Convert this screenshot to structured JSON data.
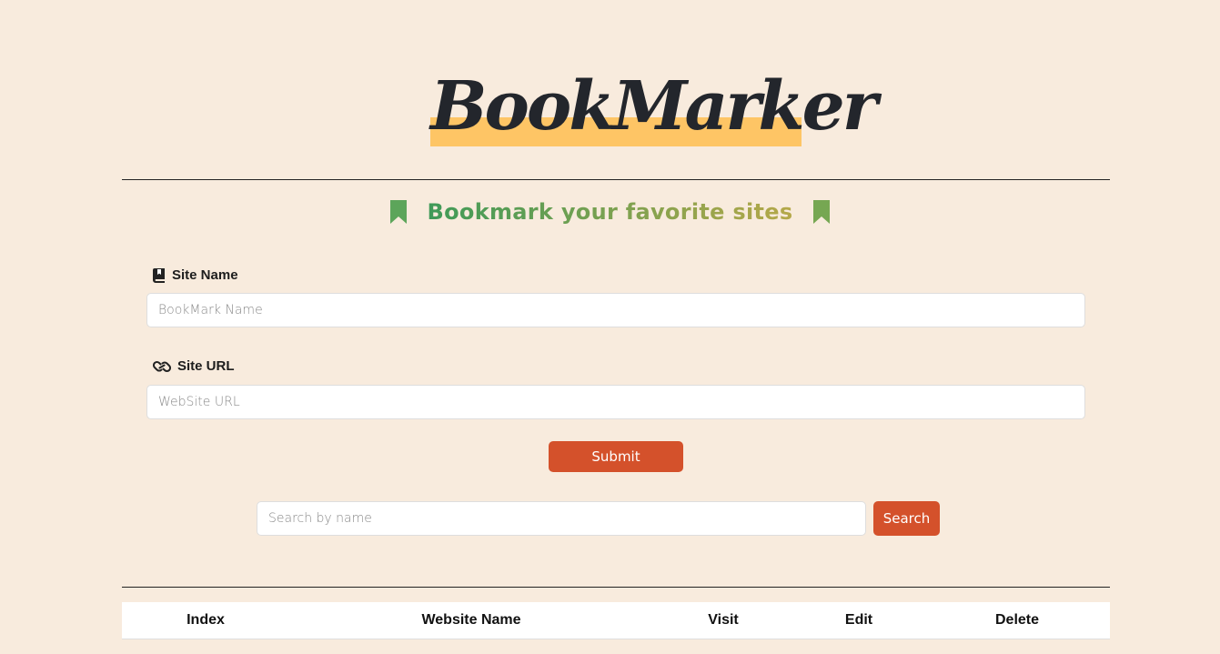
{
  "logo": {
    "text": "BookMarker"
  },
  "tagline": {
    "text": "Bookmark your favorite sites",
    "icon_left": "bookmark-icon",
    "icon_right": "bookmark-icon"
  },
  "form": {
    "site_name": {
      "label": "Site Name",
      "icon": "book-icon",
      "placeholder": "BookMark Name",
      "value": ""
    },
    "site_url": {
      "label": "Site URL",
      "icon": "link-icon",
      "placeholder": "WebSite URL",
      "value": ""
    },
    "submit_label": "Submit"
  },
  "search": {
    "placeholder": "Search by name",
    "value": "",
    "button_label": "Search"
  },
  "table": {
    "columns": [
      "Index",
      "Website Name",
      "Visit",
      "Edit",
      "Delete"
    ]
  },
  "colors": {
    "background": "#f8ebdd",
    "accent": "#d4512b",
    "logo_highlight": "#fec565",
    "tagline_start": "#3f9a58",
    "tagline_end": "#b5a849"
  }
}
